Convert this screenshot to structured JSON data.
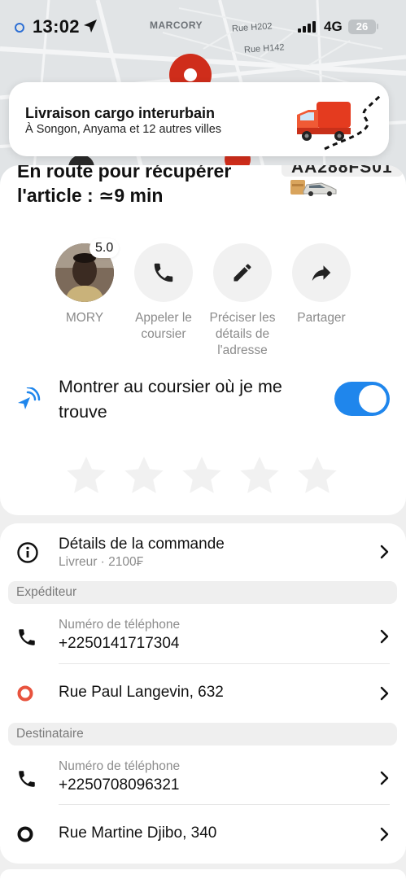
{
  "status_bar": {
    "time": "13:02",
    "network": "4G",
    "battery": "26"
  },
  "map": {
    "district_label": "MARCORY",
    "street_1": "Rue H202",
    "street_2": "Rue H142"
  },
  "promo": {
    "title": "Livraison cargo interurbain",
    "subtitle": "À Songon, Anyama et 12 autres villes"
  },
  "trip": {
    "eta_line_1": "En route pour récupérer",
    "eta_line_2": "l'article : ≃9 min",
    "plate": "AA288FS01"
  },
  "courier": {
    "name": "MORY",
    "rating": "5.0"
  },
  "actions": [
    {
      "label": "MORY",
      "icon": "avatar"
    },
    {
      "label": "Appeler le coursier",
      "icon": "phone-icon"
    },
    {
      "label": "Préciser les détails de l'adresse",
      "icon": "pencil-icon"
    },
    {
      "label": "Partager",
      "icon": "share-arrow-icon"
    }
  ],
  "location_share": {
    "label": "Montrer au coursier où je me trouve",
    "enabled": true
  },
  "rating_stars": {
    "count": 5,
    "selected": 0
  },
  "order": {
    "title": "Détails de la commande",
    "subtitle": "Livreur · 2100₣"
  },
  "sender": {
    "section_label": "Expéditeur",
    "phone_label": "Numéro de téléphone",
    "phone": "+2250141717304",
    "address": "Rue Paul Langevin, 632"
  },
  "recipient": {
    "section_label": "Destinataire",
    "phone_label": "Numéro de téléphone",
    "phone": "+2250708096321",
    "address": "Rue Martine Djibo, 340"
  },
  "colors": {
    "accent": "#1f86ec",
    "pickup_marker": "#e8533e",
    "map_pin": "#cf2d1b"
  }
}
